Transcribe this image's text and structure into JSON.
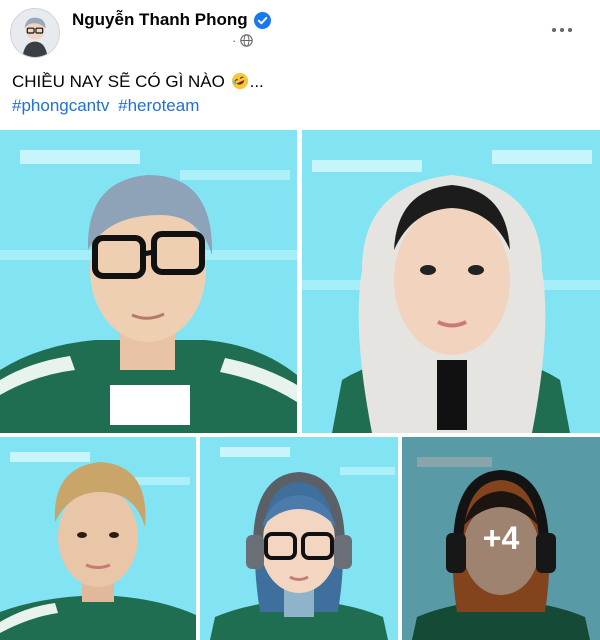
{
  "post": {
    "author": "Nguyễn Thanh Phong",
    "timestamp": "",
    "privacy_icon": "globe-icon",
    "verified_icon": "verified-badge-icon",
    "caption": "CHIỀU NAY SẼ CÓ GÌ NÀO",
    "caption_suffix": "...",
    "caption_emoji": "rolling-laughing-emoji",
    "hashtags": [
      "#phongcantv",
      "#heroteam"
    ],
    "more_photos_label": "+4"
  },
  "colors": {
    "accent": "#216fdb",
    "verified": "#1877f2",
    "background_cyan": "#7fe3f2",
    "jersey_green": "#1f6e52"
  }
}
